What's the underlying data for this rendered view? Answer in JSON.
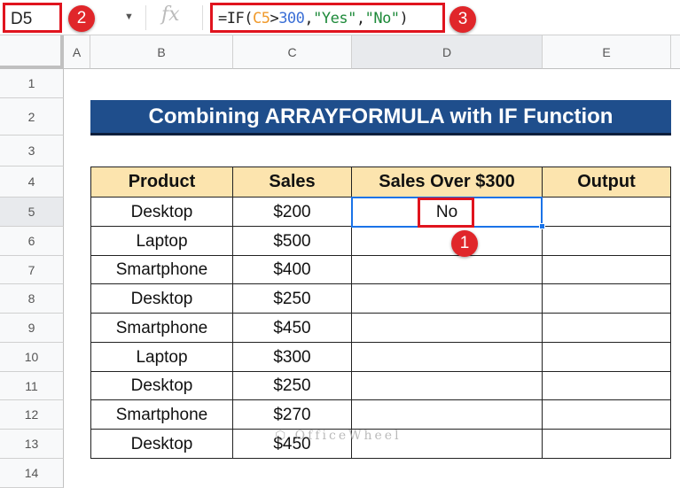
{
  "formula_bar": {
    "name_box": "D5",
    "fx_label": "fx",
    "formula_parts": [
      {
        "t": "=IF(",
        "c": "#222"
      },
      {
        "t": "C5",
        "c": "#f09a2c"
      },
      {
        "t": ">",
        "c": "#222"
      },
      {
        "t": "300",
        "c": "#3b6fd6"
      },
      {
        "t": ",",
        "c": "#222"
      },
      {
        "t": "\"Yes\"",
        "c": "#1e8a3a"
      },
      {
        "t": ",",
        "c": "#222"
      },
      {
        "t": "\"No\"",
        "c": "#1e8a3a"
      },
      {
        "t": ")",
        "c": "#222"
      }
    ]
  },
  "badges": {
    "one": "1",
    "two": "2",
    "three": "3"
  },
  "columns": [
    "A",
    "B",
    "C",
    "D",
    "E"
  ],
  "rows": [
    "1",
    "2",
    "3",
    "4",
    "5",
    "6",
    "7",
    "8",
    "9",
    "10",
    "11",
    "12",
    "13",
    "14"
  ],
  "title": "Combining ARRAYFORMULA with IF Function",
  "table": {
    "headers": [
      "Product",
      "Sales",
      "Sales Over $300",
      "Output"
    ],
    "rows": [
      [
        "Desktop",
        "$200",
        "No",
        ""
      ],
      [
        "Laptop",
        "$500",
        "",
        ""
      ],
      [
        "Smartphone",
        "$400",
        "",
        ""
      ],
      [
        "Desktop",
        "$250",
        "",
        ""
      ],
      [
        "Smartphone",
        "$450",
        "",
        ""
      ],
      [
        "Laptop",
        "$300",
        "",
        ""
      ],
      [
        "Desktop",
        "$250",
        "",
        ""
      ],
      [
        "Smartphone",
        "$270",
        "",
        ""
      ],
      [
        "Desktop",
        "$450",
        "",
        ""
      ]
    ]
  },
  "watermark": "OfficeWheel",
  "colors": {
    "title_bg": "#1f4e8c",
    "header_bg": "#fce4ae",
    "highlight": "#e0141e",
    "selection": "#1a73e8"
  }
}
